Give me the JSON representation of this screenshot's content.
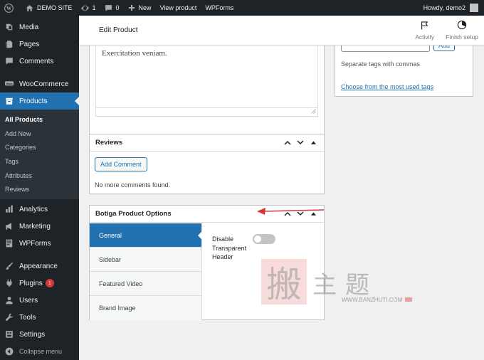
{
  "admin_bar": {
    "site_name": "DEMO SITE",
    "updates_count": "1",
    "comments_count": "0",
    "new_label": "New",
    "view_product": "View product",
    "wpforms": "WPForms",
    "howdy": "Howdy, demo2"
  },
  "sidebar": {
    "media": "Media",
    "pages": "Pages",
    "comments": "Comments",
    "woocommerce": "WooCommerce",
    "products": "Products",
    "products_sub": [
      "All Products",
      "Add New",
      "Categories",
      "Tags",
      "Attributes",
      "Reviews"
    ],
    "analytics": "Analytics",
    "marketing": "Marketing",
    "wpforms": "WPForms",
    "appearance": "Appearance",
    "plugins": "Plugins",
    "plugins_badge": "1",
    "users": "Users",
    "tools": "Tools",
    "settings": "Settings",
    "collapse": "Collapse menu"
  },
  "header": {
    "title": "Edit Product",
    "activity": "Activity",
    "finish_setup": "Finish setup"
  },
  "editor": {
    "text": "Exercitation veniam."
  },
  "reviews": {
    "title": "Reviews",
    "add_comment": "Add Comment",
    "empty": "No more comments found."
  },
  "botiga": {
    "title": "Botiga Product Options",
    "tabs": [
      "General",
      "Sidebar",
      "Featured Video",
      "Brand Image"
    ],
    "option_label": "Disable Transparent Header",
    "toggle_on": false
  },
  "tags": {
    "add": "Add",
    "hint": "Separate tags with commas",
    "most_used": "Choose from the most used tags"
  },
  "watermark": {
    "stamp": "搬",
    "chars": "主题",
    "url": "WWW.BANZHUTI.COM"
  },
  "colors": {
    "admin_dark": "#1d2327",
    "accent": "#2271b1",
    "annotation_arrow": "#d63638"
  }
}
